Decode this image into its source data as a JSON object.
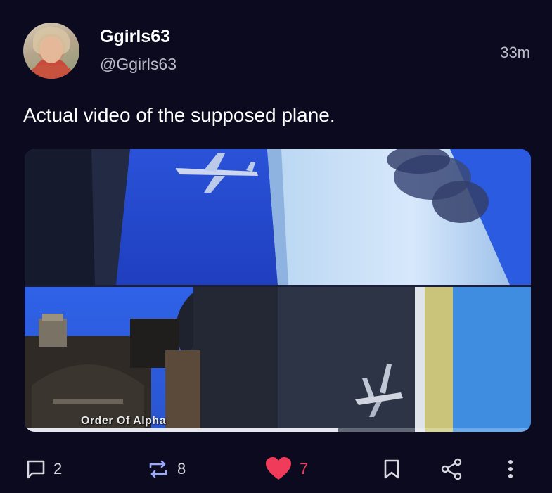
{
  "author": {
    "display_name": "Ggirls63",
    "handle": "@Ggirls63",
    "time_ago": "33m"
  },
  "post": {
    "text": "Actual video of the supposed plane."
  },
  "media": {
    "watermark": "Order Of Alpha",
    "playback_progress_fraction": 0.62
  },
  "actions": {
    "replies": "2",
    "reposts": "8",
    "likes": "7",
    "like_color": "#f03b5a"
  },
  "icons": [
    "reply-icon",
    "repost-icon",
    "heart-icon",
    "bookmark-icon",
    "share-icon",
    "more-icon"
  ]
}
